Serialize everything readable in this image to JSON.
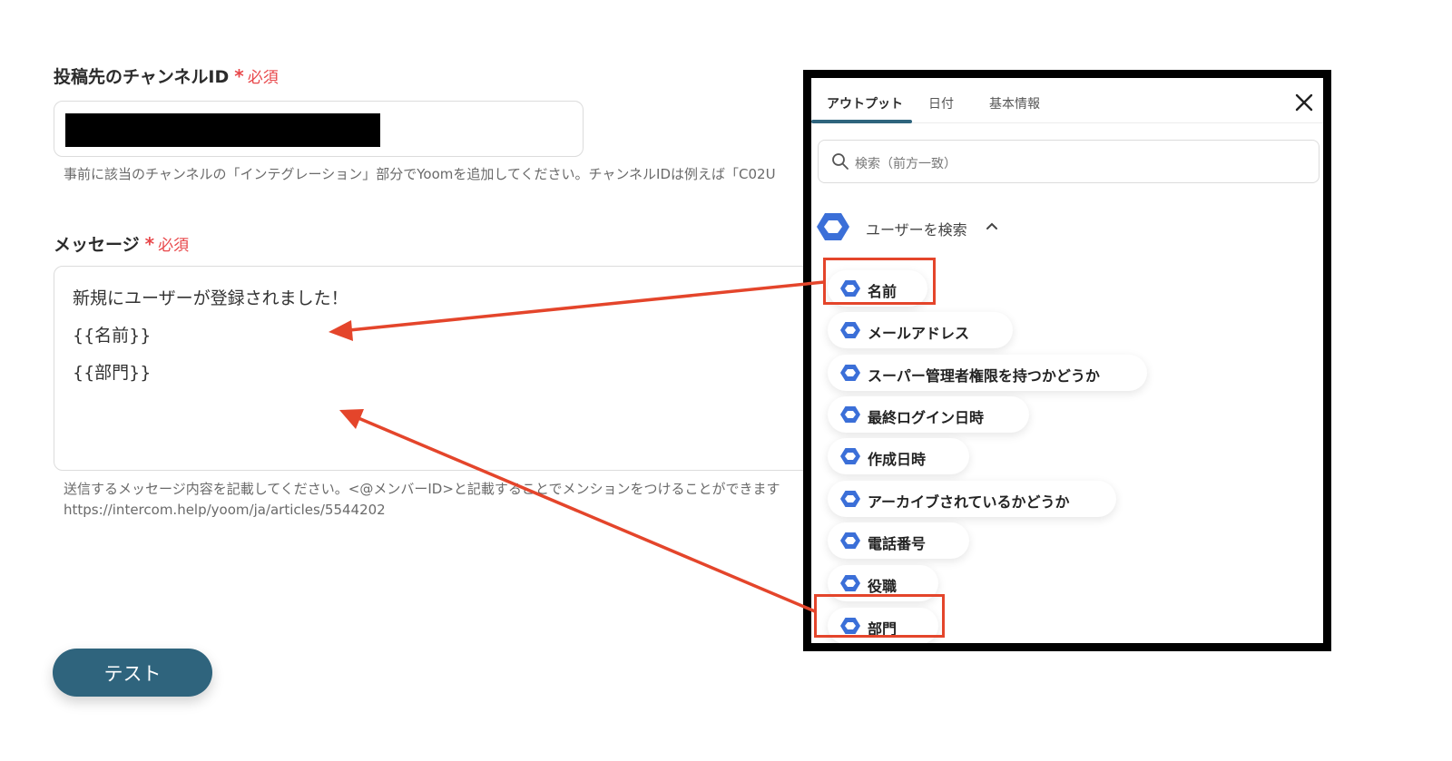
{
  "channel_field": {
    "label": "投稿先のチャンネルID",
    "required_star": "*",
    "required_text": "必須",
    "help": "事前に該当のチャンネルの「インテグレーション」部分でYoomを追加してください。チャンネルIDは例えば「C02U"
  },
  "message_field": {
    "label": "メッセージ",
    "required_star": "*",
    "required_text": "必須",
    "lines": [
      "新規にユーザーが登録されました！",
      "{{名前}}",
      "{{部門}}"
    ],
    "help_line1": "送信するメッセージ内容を記載してください。<@メンバーID>と記載することでメンションをつけることができます",
    "help_line2": "https://intercom.help/yoom/ja/articles/5544202"
  },
  "test_button": "テスト",
  "panel": {
    "tabs": [
      "アウトプット",
      "日付",
      "基本情報"
    ],
    "active_tab": "アウトプット",
    "search_placeholder": "検索（前方一致）",
    "section_title": "ユーザーを検索",
    "items": [
      "名前",
      "メールアドレス",
      "スーパー管理者権限を持つかどうか",
      "最終ログイン日時",
      "作成日時",
      "アーカイブされているかどうか",
      "電話番号",
      "役職",
      "部門"
    ],
    "highlighted_items": [
      "名前",
      "部門"
    ]
  },
  "colors": {
    "required": "#e8474a",
    "button": "#2f647d",
    "annotation": "#e4452b",
    "icon_blue": "#3b6fd8"
  }
}
